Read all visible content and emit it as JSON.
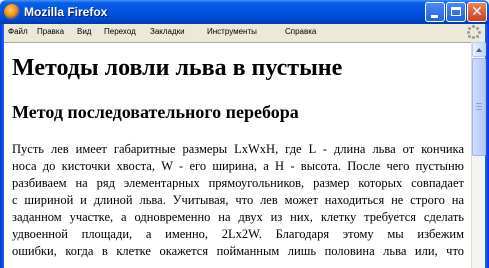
{
  "window": {
    "title": "Mozilla Firefox",
    "icon": "firefox-icon"
  },
  "titlebar_buttons": {
    "minimize_icon": "minimize-icon",
    "maximize_icon": "maximize-icon",
    "close_icon": "close-icon",
    "close_glyph": "✕"
  },
  "menu": {
    "items": [
      "Файл",
      "Правка",
      "Вид",
      "Переход",
      "Закладки",
      "Инструменты",
      "Справка"
    ]
  },
  "page": {
    "heading": "Методы ловли льва в пустыне",
    "subheading": "Метод последовательного перебора",
    "paragraph_lines": [
      "Пусть лев имеет габаритные размеры LxWxH, где L - длина льва от кончика",
      "носа до кисточки хвоста, W - его ширина, а H - высота. После чего пустыню",
      "разбиваем на ряд элементарных прямоугольников, размер которых совпадает",
      "с шириной и длиной льва. Учитывая, что лев может находиться не строго на",
      "заданном участке, а одновременно на двух из них, клетку требуется сделать",
      "удвоенной площади, а именно, 2Lx2W. Благодаря этому мы избежим",
      "ошибки, когда в клетке окажется пойманным лишь половина льва или, что"
    ]
  },
  "colors": {
    "titlebar": "#0055e5",
    "chrome": "#ece9d8",
    "content_bg": "#ffffff"
  }
}
